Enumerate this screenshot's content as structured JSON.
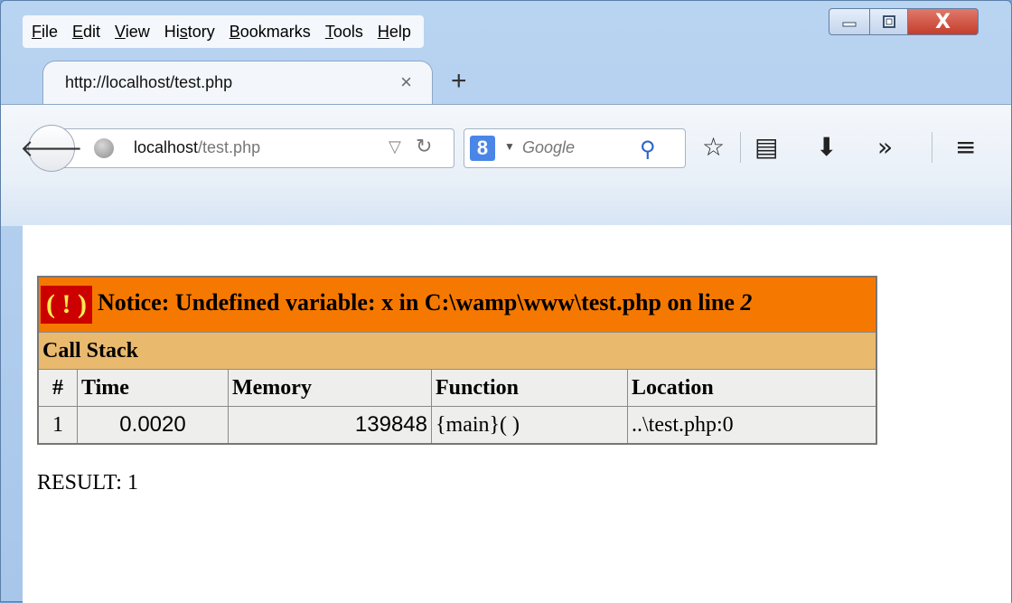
{
  "menubar": {
    "items": [
      "File",
      "Edit",
      "View",
      "History",
      "Bookmarks",
      "Tools",
      "Help"
    ]
  },
  "window": {
    "minimize_icon": "minimize-icon",
    "maximize_icon": "maximize-icon",
    "close_label": "X"
  },
  "tab": {
    "title": "http://localhost/test.php",
    "close_label": "×",
    "new_tab_label": "+"
  },
  "navbar": {
    "url_host": "localhost",
    "url_path": "/test.php",
    "search_engine_letter": "8",
    "search_placeholder": "Google"
  },
  "page": {
    "notice": {
      "badge": "( ! )",
      "message": "Notice: Undefined variable: x in C:\\wamp\\www\\test.php on line ",
      "line": "2"
    },
    "call_stack_label": "Call Stack",
    "columns": [
      "#",
      "Time",
      "Memory",
      "Function",
      "Location"
    ],
    "rows": [
      {
        "num": "1",
        "time": "0.0020",
        "memory": "139848",
        "function": "{main}( )",
        "location": "..\\test.php:0"
      }
    ],
    "result": "RESULT: 1"
  },
  "colors": {
    "notice_bg": "#f57900",
    "callstack_bg": "#e9b96e",
    "cell_bg": "#eeeeec",
    "bang_bg": "#cc0000",
    "bang_fg": "#fce94f"
  }
}
